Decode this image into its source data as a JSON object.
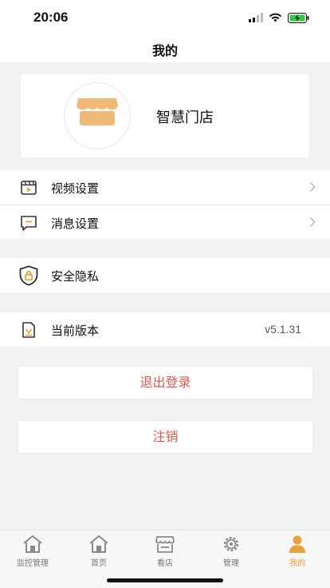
{
  "status_bar": {
    "time": "20:06"
  },
  "header": {
    "title": "我的"
  },
  "profile": {
    "store_name": "智慧门店"
  },
  "settings_group": [
    {
      "label": "视频设置",
      "icon": "video-settings-icon"
    },
    {
      "label": "消息设置",
      "icon": "message-settings-icon"
    }
  ],
  "privacy": {
    "label": "安全隐私",
    "icon": "shield-lock-icon"
  },
  "version": {
    "label": "当前版本",
    "value": "v5.1.31",
    "icon": "version-doc-icon"
  },
  "buttons": {
    "logout": "退出登录",
    "cancel_account": "注销"
  },
  "tabs": [
    {
      "label": "监控管理",
      "icon": "house-icon"
    },
    {
      "label": "首页",
      "icon": "house-icon"
    },
    {
      "label": "看店",
      "icon": "store-icon"
    },
    {
      "label": "管理",
      "icon": "gear-icon"
    },
    {
      "label": "我的",
      "icon": "person-icon",
      "active": true
    }
  ],
  "colors": {
    "accent": "#e8a13b",
    "danger_text": "#e05a4e",
    "background": "#f2f2f2"
  }
}
